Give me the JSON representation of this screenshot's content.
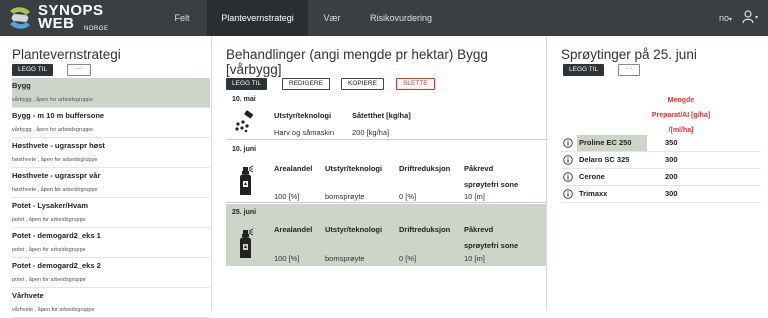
{
  "header": {
    "logo_top": "SYNOPS",
    "logo_mid": "WEB",
    "logo_sub": "NORGE",
    "nav": [
      "Felt",
      "Plantevernstrategi",
      "Vær",
      "Risikovurdering"
    ],
    "active_nav": "Plantevernstrategi",
    "language": "no",
    "lang_caret": "▾",
    "user_caret": "▾"
  },
  "strategy_panel": {
    "title": "Plantevernstrategi",
    "add_label": "LEGG TIL",
    "more_label": "···",
    "items": [
      {
        "title": "Bygg",
        "sub": "vårbygg , åpen for arbeidsgruppe",
        "selected": true
      },
      {
        "title": "Bygg - m 10 m buffersone",
        "sub": "vårbygg , åpen for arbeidsgruppe",
        "selected": false
      },
      {
        "title": "Høsthvete - ugrasspr høst",
        "sub": "høsthvete , åpen for arbeidsgruppe",
        "selected": false
      },
      {
        "title": "Høsthvete - ugrasspr vår",
        "sub": "høsthvete , åpen for arbeidsgruppe",
        "selected": false
      },
      {
        "title": "Potet - Lysaker/Hvam",
        "sub": "potet , åpen for arbeidsgruppe",
        "selected": false
      },
      {
        "title": "Potet - demogard2_eks 1",
        "sub": "potet , åpen for arbeidsgruppe",
        "selected": false
      },
      {
        "title": "Potet - demogard2_eks 2",
        "sub": "potet , åpen for arbeidsgruppe",
        "selected": false
      },
      {
        "title": "Vårhvete",
        "sub": "vårhvete , åpen for arbeidsgruppe",
        "selected": false
      }
    ]
  },
  "treatments_panel": {
    "title_line1": "Behandlinger (angi mengde pr hektar) Bygg",
    "title_line2": "[vårbygg]",
    "add_label": "LEGG TIL",
    "edit_label": "REDIGERE",
    "copy_label": "KOPIERE",
    "delete_label": "SLETTE",
    "entries": [
      {
        "date": "10. mai",
        "headers": [
          "Utstyr/teknologi",
          "Såtetthet [kg/ha]"
        ],
        "values": [
          "Harv og såmaskin",
          "200 [kg/ha]"
        ]
      },
      {
        "date": "10. juni",
        "headers": [
          "Arealandel",
          "Utstyr/teknologi",
          "Driftreduksjon",
          "Påkrevd",
          "sprøytefri sone"
        ],
        "values": [
          "100 [%]",
          "bomsprøyte",
          "0 [%]",
          "10 [m]"
        ]
      },
      {
        "date": "25. juni",
        "headers": [
          "Arealandel",
          "Utstyr/teknologi",
          "Driftreduksjon",
          "Påkrevd",
          "sprøytefri sone"
        ],
        "values": [
          "100 [%]",
          "bomsprøyte",
          "0 [%]",
          "10 [m]"
        ]
      }
    ]
  },
  "sprayings_panel": {
    "title": "Sprøytinger på 25. juni",
    "add_label": "LEGG TIL",
    "more_label": "···",
    "amount_header_line1": "Mengde",
    "amount_header_line2": "Preparat/AI [g/ha]",
    "amount_header_line3": "/[ml/ha]",
    "products": [
      {
        "name": "Proline EC 250",
        "amount": "350",
        "highlighted": true
      },
      {
        "name": "Delaro SC 325",
        "amount": "300",
        "highlighted": false
      },
      {
        "name": "Cerone",
        "amount": "200",
        "highlighted": false
      },
      {
        "name": "Trimaxx",
        "amount": "300",
        "highlighted": false
      }
    ]
  }
}
